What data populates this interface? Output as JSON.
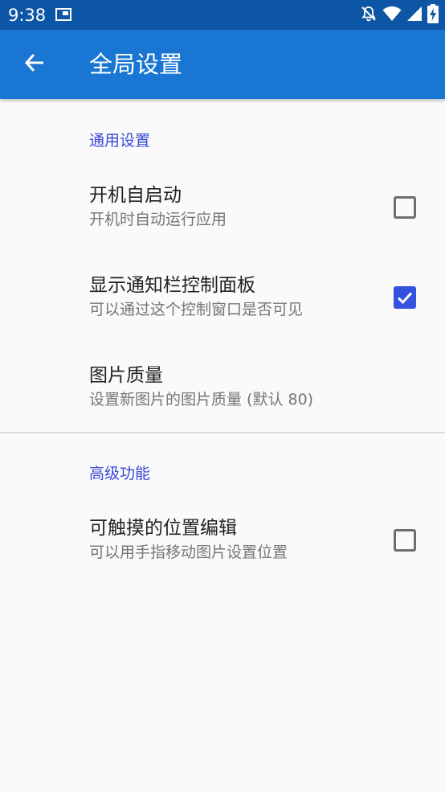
{
  "status_bar": {
    "time": "9:38",
    "icons": [
      "screen-record-icon",
      "notifications-off-icon",
      "wifi-icon",
      "signal-icon",
      "battery-charging-icon"
    ]
  },
  "app_bar": {
    "title": "全局设置",
    "back_icon": "arrow-back-icon"
  },
  "sections": [
    {
      "header": "通用设置",
      "items": [
        {
          "title": "开机自启动",
          "summary": "开机时自动运行应用",
          "checkbox": true,
          "checked": false
        },
        {
          "title": "显示通知栏控制面板",
          "summary": "可以通过这个控制窗口是否可见",
          "checkbox": true,
          "checked": true
        },
        {
          "title": "图片质量",
          "summary": "设置新图片的图片质量 (默认 80)",
          "checkbox": false
        }
      ]
    },
    {
      "header": "高级功能",
      "items": [
        {
          "title": "可触摸的位置编辑",
          "summary": "可以用手指移动图片设置位置",
          "checkbox": true,
          "checked": false
        }
      ]
    }
  ],
  "colors": {
    "status_bar": "#0d56a6",
    "app_bar": "#1976d2",
    "accent": "#3451e0",
    "section_header": "#3949d6",
    "background": "#fafafa"
  }
}
